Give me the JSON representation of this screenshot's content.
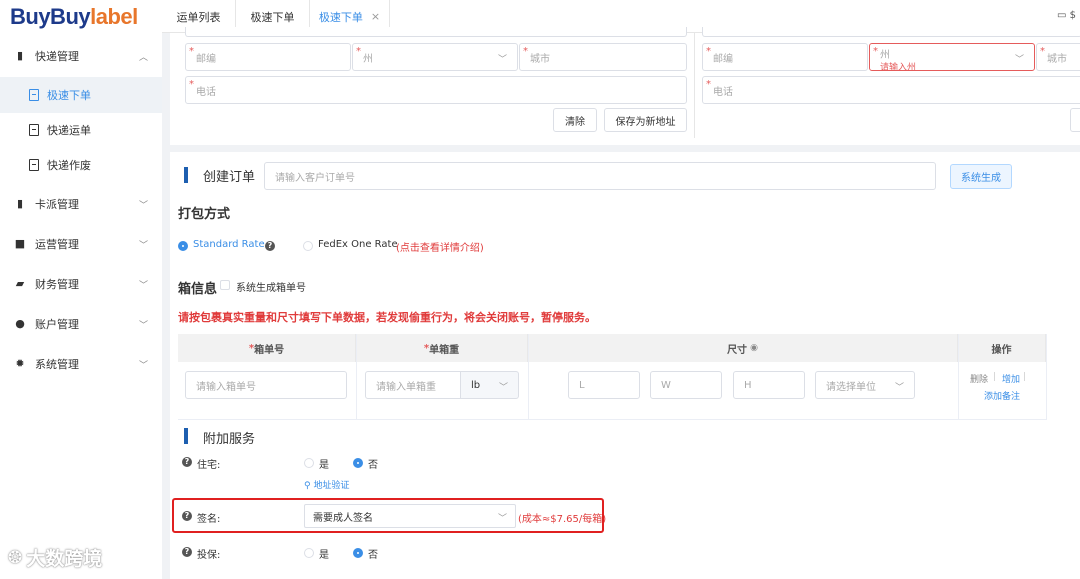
{
  "brand": {
    "part1": "BuyBuy",
    "part2": "label"
  },
  "sidebar": {
    "groups": [
      {
        "label": "快递管理",
        "icon": "clipboard-icon",
        "chevron": "︿"
      },
      {
        "label": "卡派管理",
        "icon": "clipboard-icon",
        "chevron": "﹀"
      },
      {
        "label": "运营管理",
        "icon": "camera-icon",
        "chevron": "﹀"
      },
      {
        "label": "财务管理",
        "icon": "wallet-icon",
        "chevron": "﹀"
      },
      {
        "label": "账户管理",
        "icon": "user-icon",
        "chevron": "﹀"
      },
      {
        "label": "系统管理",
        "icon": "gear-icon",
        "chevron": "﹀"
      }
    ],
    "sub_items": [
      {
        "label": "极速下单",
        "active": true
      },
      {
        "label": "快递运单",
        "active": false
      },
      {
        "label": "快递作废",
        "active": false
      }
    ]
  },
  "tabs": [
    {
      "label": "运单列表"
    },
    {
      "label": "极速下单"
    },
    {
      "label": "极速下单",
      "active": true,
      "close": "×"
    }
  ],
  "top_right": "$",
  "sender": {
    "zip_placeholder": "邮编",
    "state_placeholder": "州",
    "city_placeholder": "城市",
    "phone_placeholder": "电话",
    "clear_label": "清除",
    "save_label": "保存为新地址"
  },
  "receiver": {
    "zip_placeholder": "邮编",
    "state_placeholder": "州",
    "state_error": "请输入州",
    "city_placeholder": "城市",
    "phone_placeholder": "电话"
  },
  "order": {
    "title": "创建订单",
    "order_no_placeholder": "请输入客户订单号",
    "generate_label": "系统生成"
  },
  "packing": {
    "title": "打包方式",
    "option1": "Standard Rate",
    "option2": "FedEx One Rate",
    "option2_note": "(点击查看详情介绍)",
    "selected": "Standard Rate"
  },
  "box": {
    "title": "箱信息",
    "auto_label": "系统生成箱单号",
    "warning": "请按包裹真实重量和尺寸填写下单数据，若发现偷重行为，将会关闭账号，暂停服务。",
    "columns": [
      "箱单号",
      "单箱重",
      "尺寸",
      "操作"
    ],
    "box_no_placeholder": "请输入箱单号",
    "weight_placeholder": "请输入单箱重",
    "weight_unit": "lb",
    "l": "L",
    "w": "W",
    "h": "H",
    "unit_placeholder": "请选择单位",
    "actions": {
      "delete": "删除",
      "add": "增加",
      "add_note": "添加备注"
    }
  },
  "services": {
    "title": "附加服务",
    "residential": {
      "label": "住宅:",
      "yes": "是",
      "no": "否",
      "selected": "否",
      "verify": "地址验证"
    },
    "signature": {
      "label": "签名:",
      "value": "需要成人签名",
      "cost": "(成本≈$7.65/每箱)"
    },
    "insurance": {
      "label": "投保:",
      "yes": "是",
      "no": "否",
      "selected": "否"
    }
  },
  "watermark": "大数跨境"
}
